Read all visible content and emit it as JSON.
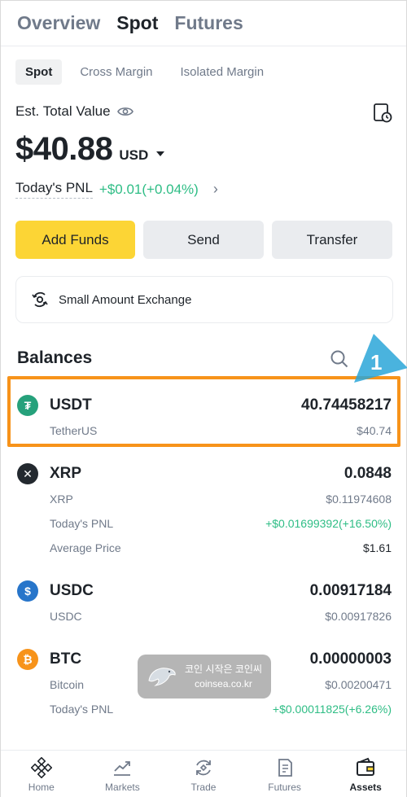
{
  "top_tabs": [
    {
      "label": "Overview",
      "active": false
    },
    {
      "label": "Spot",
      "active": true
    },
    {
      "label": "Futures",
      "active": false
    }
  ],
  "sub_tabs": [
    {
      "label": "Spot",
      "active": true
    },
    {
      "label": "Cross Margin",
      "active": false
    },
    {
      "label": "Isolated Margin",
      "active": false
    }
  ],
  "summary": {
    "est_label": "Est. Total Value",
    "total_value": "$40.88",
    "currency": "USD",
    "pnl_label": "Today's PNL",
    "pnl_value": "+$0.01(+0.04%)"
  },
  "actions": {
    "add_funds": "Add Funds",
    "send": "Send",
    "transfer": "Transfer"
  },
  "small_exchange": {
    "label": "Small Amount Exchange"
  },
  "balances": {
    "title": "Balances",
    "hint_number": "1",
    "assets": [
      {
        "symbol": "USDT",
        "name": "TetherUS",
        "amount": "40.74458217",
        "usd_value": "$40.74",
        "icon_color": "#26a17b"
      },
      {
        "symbol": "XRP",
        "name": "XRP",
        "amount": "0.0848",
        "usd_value": "$0.11974608",
        "icon_color": "#23292f",
        "pnl_label": "Today's PNL",
        "pnl_value": "+$0.01699392(+16.50%)",
        "avg_label": "Average Price",
        "avg_value": "$1.61"
      },
      {
        "symbol": "USDC",
        "name": "USDC",
        "amount": "0.00917184",
        "usd_value": "$0.00917826",
        "icon_color": "#2775ca"
      },
      {
        "symbol": "BTC",
        "name": "Bitcoin",
        "amount": "0.00000003",
        "usd_value": "$0.00200471",
        "icon_color": "#f7931a",
        "pnl_label": "Today's PNL",
        "pnl_value": "+$0.00011825(+6.26%)"
      }
    ]
  },
  "watermark": {
    "line1": "코인 시작은 코인씨",
    "line2": "coinsea.co.kr"
  },
  "bottom_nav": [
    {
      "label": "Home",
      "icon": "binance-logo-icon",
      "active": false
    },
    {
      "label": "Markets",
      "icon": "chart-icon",
      "active": false
    },
    {
      "label": "Trade",
      "icon": "trade-icon",
      "active": false
    },
    {
      "label": "Futures",
      "icon": "futures-icon",
      "active": false
    },
    {
      "label": "Assets",
      "icon": "wallet-icon",
      "active": true
    }
  ],
  "colors": {
    "accent": "#fcd535",
    "positive": "#2ebd85",
    "highlight": "#f7931a",
    "hint": "#2aa6d8"
  }
}
